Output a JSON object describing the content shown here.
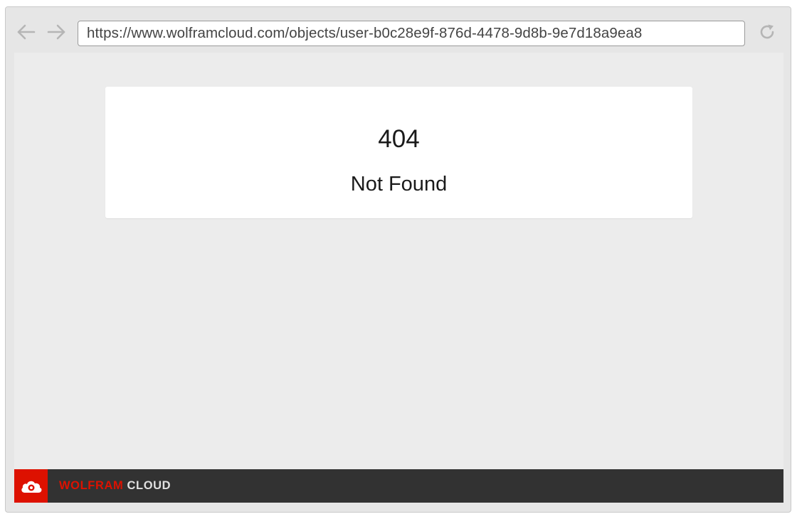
{
  "browser": {
    "url": "https://www.wolframcloud.com/objects/user-b0c28e9f-876d-4478-9d8b-9e7d18a9ea8",
    "back_icon": "arrow-left-icon",
    "forward_icon": "arrow-right-icon",
    "reload_icon": "reload-icon"
  },
  "error": {
    "code": "404",
    "message": "Not Found"
  },
  "footer": {
    "brand_primary": "WOLFRAM",
    "brand_secondary": "CLOUD",
    "logo_icon": "wolfram-cloud-logo-icon"
  },
  "colors": {
    "brand_red": "#dd1100",
    "footer_bg": "#323232",
    "content_bg": "#ececec"
  }
}
